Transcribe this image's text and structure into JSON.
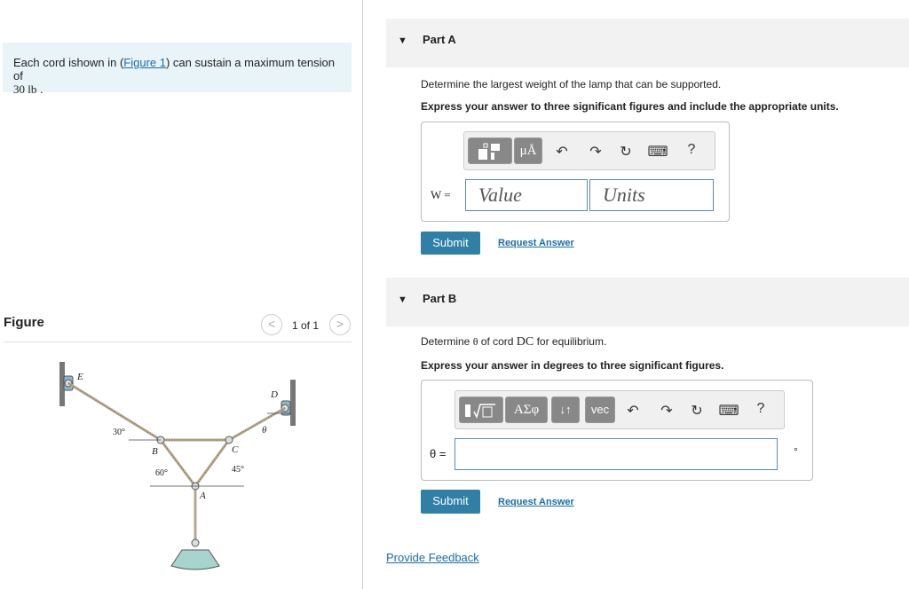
{
  "problem": {
    "text_before": "Each cord ishown in (",
    "link": "Figure 1",
    "text_after": ") can sustain a maximum tension of",
    "value": "30 lb",
    "end": " ."
  },
  "figure": {
    "title": "Figure",
    "prev": "<",
    "next": ">",
    "counter": "1 of 1",
    "labels": {
      "E": "E",
      "D": "D",
      "B": "B",
      "C": "C",
      "A": "A",
      "theta": "θ",
      "a30": "30°",
      "a60": "60°",
      "a45": "45°"
    }
  },
  "partA": {
    "title": "Part A",
    "question": "Determine the largest weight of the lamp that can be supported.",
    "instructions": "Express your answer to three significant figures and include the appropriate units.",
    "toolbar": {
      "units_btn": "μÅ",
      "help": "?"
    },
    "var_label": "W =",
    "value_placeholder": "Value",
    "units_placeholder": "Units",
    "submit": "Submit",
    "request": "Request Answer"
  },
  "partB": {
    "title": "Part B",
    "question_pre": "Determine ",
    "theta": "θ",
    "question_mid": " of cord ",
    "cord": "DC",
    "question_post": " for equilibrium.",
    "instructions": "Express your answer in degrees to three significant figures.",
    "toolbar": {
      "greek_btn": "ΑΣφ",
      "arrows_btn": "↓↑",
      "vec_btn": "vec",
      "help": "?"
    },
    "var_label": "θ =",
    "unit": "°",
    "submit": "Submit",
    "request": "Request Answer"
  },
  "feedback": "Provide Feedback",
  "colors": {
    "accent": "#2f7fa6",
    "link": "#1a6ea8",
    "problem_bg": "#e8f4f8"
  }
}
